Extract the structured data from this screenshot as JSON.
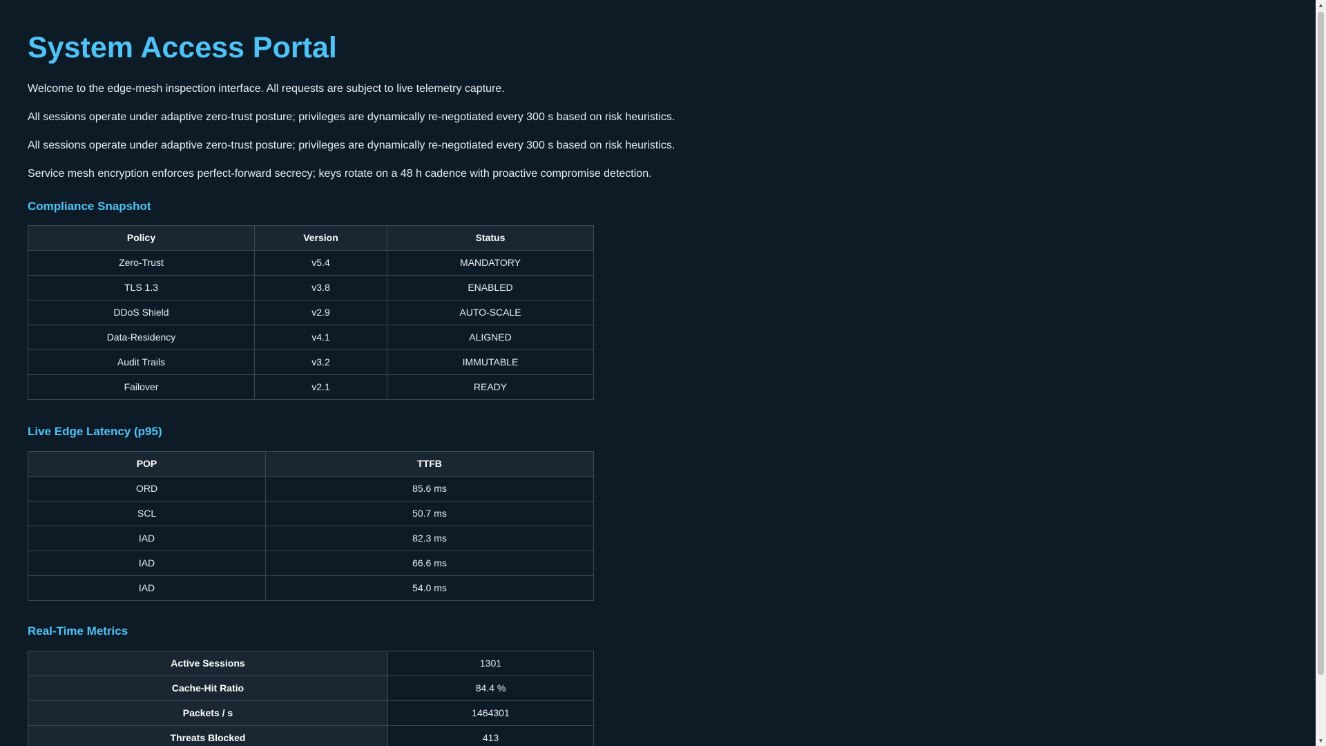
{
  "page": {
    "title": "System Access Portal",
    "paragraphs": [
      "Welcome to the edge-mesh inspection interface. All requests are subject to live telemetry capture.",
      "All sessions operate under adaptive zero-trust posture; privileges are dynamically re-negotiated every 300 s based on risk heuristics.",
      "All sessions operate under adaptive zero-trust posture; privileges are dynamically re-negotiated every 300 s based on risk heuristics.",
      "Service mesh encryption enforces perfect-forward secrecy; keys rotate on a 48 h cadence with proactive compromise detection."
    ]
  },
  "compliance": {
    "heading": "Compliance Snapshot",
    "columns": [
      "Policy",
      "Version",
      "Status"
    ],
    "rows": [
      [
        "Zero-Trust",
        "v5.4",
        "MANDATORY"
      ],
      [
        "TLS 1.3",
        "v3.8",
        "ENABLED"
      ],
      [
        "DDoS Shield",
        "v2.9",
        "AUTO-SCALE"
      ],
      [
        "Data-Residency",
        "v4.1",
        "ALIGNED"
      ],
      [
        "Audit Trails",
        "v3.2",
        "IMMUTABLE"
      ],
      [
        "Failover",
        "v2.1",
        "READY"
      ]
    ]
  },
  "latency": {
    "heading": "Live Edge Latency (p95)",
    "columns": [
      "POP",
      "TTFB"
    ],
    "rows": [
      [
        "ORD",
        "85.6 ms"
      ],
      [
        "SCL",
        "50.7 ms"
      ],
      [
        "IAD",
        "82.3 ms"
      ],
      [
        "IAD",
        "66.6 ms"
      ],
      [
        "IAD",
        "54.0 ms"
      ]
    ]
  },
  "metrics": {
    "heading": "Real-Time Metrics",
    "rows": [
      [
        "Active Sessions",
        "1301"
      ],
      [
        "Cache-Hit Ratio",
        "84.4 %"
      ],
      [
        "Packets / s",
        "1464301"
      ],
      [
        "Threats Blocked",
        "413"
      ]
    ]
  },
  "colors": {
    "background": "#0d1b27",
    "accent": "#4fc3f7",
    "text": "#e8eef2",
    "header_bg": "#1a2733",
    "border": "#3a4a57"
  }
}
